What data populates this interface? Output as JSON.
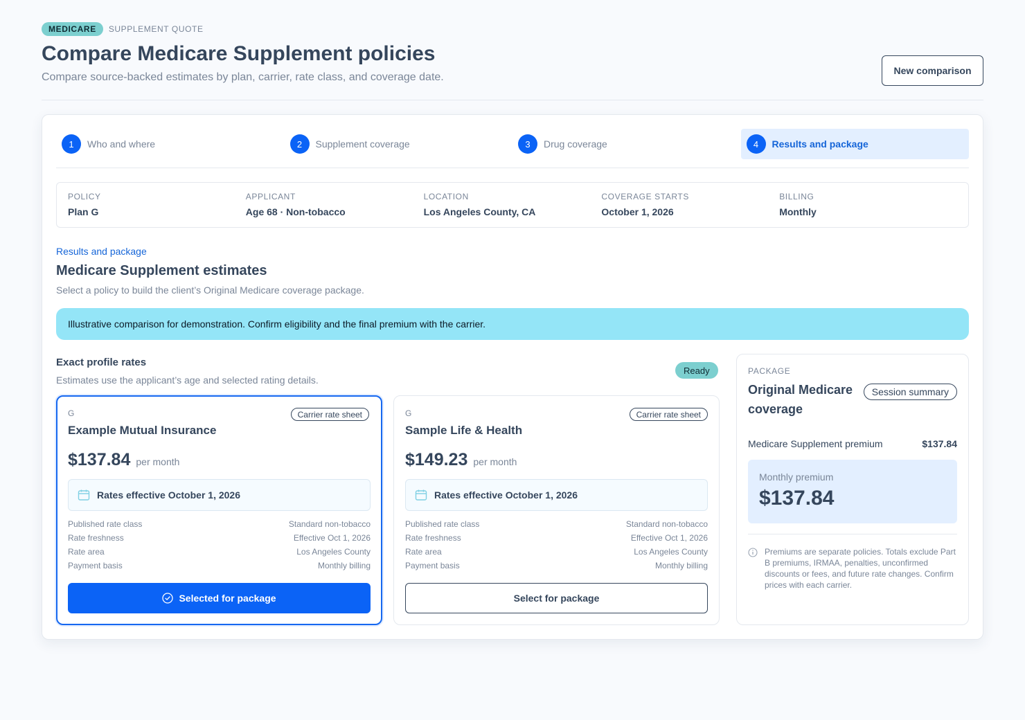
{
  "header": {
    "badge": "MEDICARE",
    "eyebrow": "SUPPLEMENT QUOTE",
    "title": "Compare Medicare Supplement policies",
    "subtitle": "Compare source-backed estimates by plan, carrier, rate class, and coverage date.",
    "new_button": "New comparison"
  },
  "steps": [
    {
      "num": "1",
      "label": "Who and where"
    },
    {
      "num": "2",
      "label": "Supplement coverage"
    },
    {
      "num": "3",
      "label": "Drug coverage"
    },
    {
      "num": "4",
      "label": "Results and package"
    }
  ],
  "summary": [
    {
      "label": "POLICY",
      "value": "Plan G"
    },
    {
      "label": "APPLICANT",
      "value": "Age 68 · Non-tobacco"
    },
    {
      "label": "LOCATION",
      "value": "Los Angeles County, CA"
    },
    {
      "label": "COVERAGE STARTS",
      "value": "October 1, 2026"
    },
    {
      "label": "BILLING",
      "value": "Monthly"
    }
  ],
  "section": {
    "link": "Results and package",
    "title": "Medicare Supplement estimates",
    "subtitle": "Select a policy to build the client’s Original Medicare coverage package.",
    "notice": "Illustrative comparison for demonstration. Confirm eligibility and the final premium with the carrier."
  },
  "rates": {
    "title": "Exact profile rates",
    "subtitle": "Estimates use the applicant’s age and selected rating details.",
    "status": "Ready"
  },
  "offers": [
    {
      "plan": "G",
      "source": "Carrier rate sheet",
      "carrier": "Example Mutual Insurance",
      "price": "$137.84",
      "per": "per month",
      "effective": "Rates effective October 1, 2026",
      "rows": [
        {
          "label": "Published rate class",
          "value": "Standard non-tobacco"
        },
        {
          "label": "Rate freshness",
          "value": "Effective Oct 1, 2026"
        },
        {
          "label": "Rate area",
          "value": "Los Angeles County"
        },
        {
          "label": "Payment basis",
          "value": "Monthly billing"
        }
      ],
      "button": "Selected for package"
    },
    {
      "plan": "G",
      "source": "Carrier rate sheet",
      "carrier": "Sample Life & Health",
      "price": "$149.23",
      "per": "per month",
      "effective": "Rates effective October 1, 2026",
      "rows": [
        {
          "label": "Published rate class",
          "value": "Standard non-tobacco"
        },
        {
          "label": "Rate freshness",
          "value": "Effective Oct 1, 2026"
        },
        {
          "label": "Rate area",
          "value": "Los Angeles County"
        },
        {
          "label": "Payment basis",
          "value": "Monthly billing"
        }
      ],
      "button": "Select for package"
    }
  ],
  "package": {
    "eyebrow": "PACKAGE",
    "title": "Original Medicare coverage",
    "badge": "Session summary",
    "line_label": "Medicare Supplement premium",
    "line_value": "$137.84",
    "total_label": "Monthly premium",
    "total_value": "$137.84",
    "note": "Premiums are separate policies. Totals exclude Part B premiums, IRMAA, penalties, unconfirmed discounts or fees, and future rate changes. Confirm prices with each carrier."
  },
  "colors": {
    "accent": "#0b63f6",
    "teal_badge": "#7ccfcf",
    "notice": "#94e5f7",
    "active_step": "#e3efff"
  }
}
